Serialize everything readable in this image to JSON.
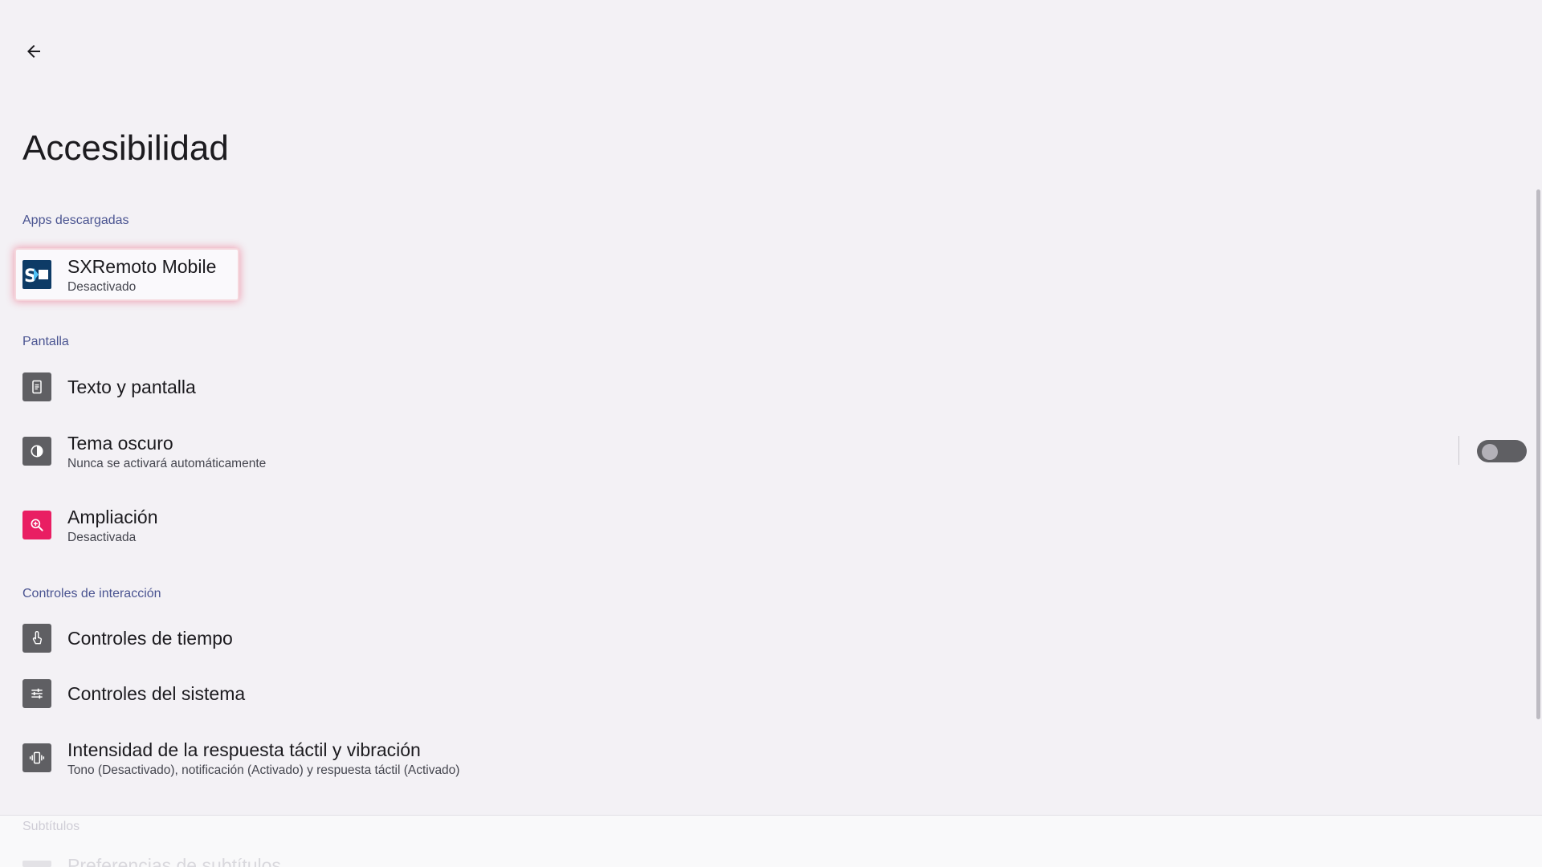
{
  "header": {
    "back_icon": "arrow-back-icon",
    "title": "Accesibilidad"
  },
  "sections": [
    {
      "header": "Apps descargadas",
      "items": [
        {
          "title": "SXRemoto Mobile",
          "subtitle": "Desactivado",
          "icon": "sxremoto-app-icon",
          "focused": true
        }
      ]
    },
    {
      "header": "Pantalla",
      "items": [
        {
          "title": "Texto y pantalla",
          "icon": "text-display-icon"
        },
        {
          "title": "Tema oscuro",
          "subtitle": "Nunca se activará automáticamente",
          "icon": "dark-theme-icon",
          "toggle": false
        },
        {
          "title": "Ampliación",
          "subtitle": "Desactivada",
          "icon": "magnification-icon",
          "icon_color": "#e91e63"
        }
      ]
    },
    {
      "header": "Controles de interacción",
      "items": [
        {
          "title": "Controles de tiempo",
          "icon": "timing-controls-icon"
        },
        {
          "title": "Controles del sistema",
          "icon": "system-controls-icon"
        },
        {
          "title": "Intensidad de la respuesta táctil y vibración",
          "subtitle": "Tono (Desactivado), notificación (Activado) y respuesta táctil (Activado)",
          "icon": "vibration-icon"
        }
      ]
    },
    {
      "header": "Subtítulos",
      "items": [
        {
          "title": "Preferencias de subtítulos",
          "icon": "captions-icon"
        }
      ]
    }
  ],
  "colors": {
    "background": "#f3f1f5",
    "section_header": "#4a5491",
    "icon_bg": "#5f5f63",
    "magnification_bg": "#e91e63",
    "focus_ring": "#ec4064",
    "sxremoto_blue": "#0d3b66"
  }
}
